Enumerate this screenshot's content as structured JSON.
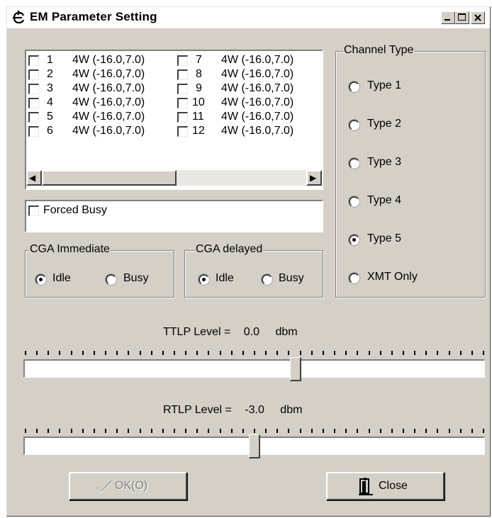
{
  "window": {
    "title": "EM Parameter Setting",
    "controls": [
      "minimize",
      "maximize",
      "close"
    ]
  },
  "channels": {
    "col1": [
      {
        "num": "1",
        "value": "4W (-16.0,7.0)"
      },
      {
        "num": "2",
        "value": "4W (-16.0,7.0)"
      },
      {
        "num": "3",
        "value": "4W (-16.0,7.0)"
      },
      {
        "num": "4",
        "value": "4W (-16.0,7.0)"
      },
      {
        "num": "5",
        "value": "4W (-16.0,7.0)"
      },
      {
        "num": "6",
        "value": "4W (-16.0,7.0)"
      }
    ],
    "col2": [
      {
        "num": "7",
        "value": "4W (-16.0,7.0)"
      },
      {
        "num": "8",
        "value": "4W (-16.0,7.0)"
      },
      {
        "num": "9",
        "value": "4W (-16.0,7.0)"
      },
      {
        "num": "10",
        "value": "4W (-16.0,7.0)"
      },
      {
        "num": "11",
        "value": "4W (-16.0,7.0)"
      },
      {
        "num": "12",
        "value": "4W (-16.0,7.0)"
      }
    ],
    "scroll_left": "◀",
    "scroll_right": "▶"
  },
  "forced_busy": {
    "label": "Forced Busy",
    "checked": false
  },
  "cga_immediate": {
    "title": "CGA Immediate",
    "options": [
      "Idle",
      "Busy"
    ],
    "selected": "Idle"
  },
  "cga_delayed": {
    "title": "CGA delayed",
    "options": [
      "Idle",
      "Busy"
    ],
    "selected": "Idle"
  },
  "channel_type": {
    "title": "Channel Type",
    "options": [
      "Type 1",
      "Type 2",
      "Type 3",
      "Type 4",
      "Type 5",
      "XMT Only"
    ],
    "selected": "Type 5"
  },
  "ttlp": {
    "label": "TTLP Level =",
    "value": "0.0",
    "unit": "dbm",
    "position_fraction": 0.59
  },
  "rtlp": {
    "label": "RTLP Level =",
    "value": "-3.0",
    "unit": "dbm",
    "position_fraction": 0.5
  },
  "buttons": {
    "ok": "OK(O)",
    "close": "Close"
  },
  "colors": {
    "face": "#d4d0c8",
    "disabled_text": "#808080"
  }
}
